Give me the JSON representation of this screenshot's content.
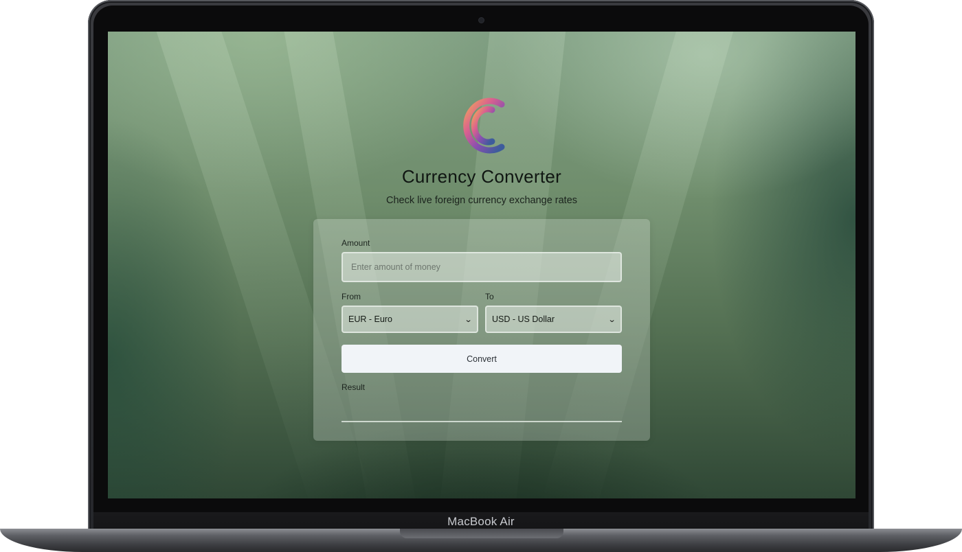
{
  "device": {
    "brand_label": "MacBook Air"
  },
  "app": {
    "title": "Currency Converter",
    "subtitle": "Check live foreign currency exchange rates",
    "logo_icon": "euro-coin-icon"
  },
  "form": {
    "amount_label": "Amount",
    "amount_placeholder": "Enter amount of money",
    "amount_value": "",
    "from_label": "From",
    "from_selected": "EUR - Euro",
    "to_label": "To",
    "to_selected": "USD - US Dollar",
    "convert_label": "Convert",
    "result_label": "Result",
    "result_value": ""
  },
  "colors": {
    "button_bg": "#f1f4f8",
    "logo_gradient": [
      "#f2a65a",
      "#d9608f",
      "#8a4fb0",
      "#3d5c9c"
    ]
  }
}
